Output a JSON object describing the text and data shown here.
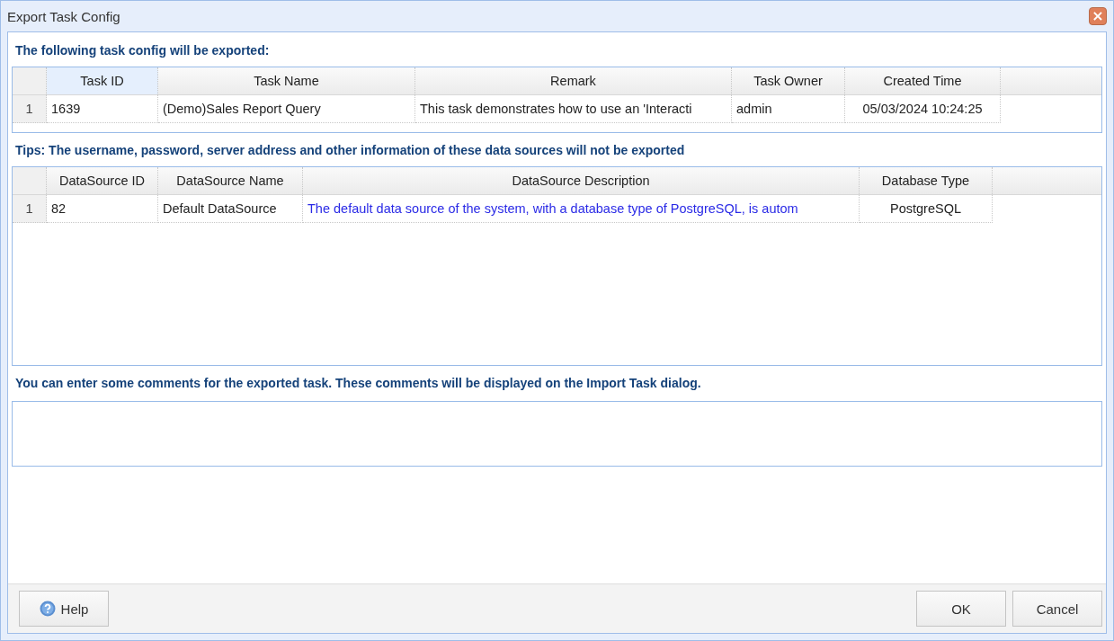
{
  "window": {
    "title": "Export Task Config",
    "close": "×"
  },
  "task_section": {
    "heading": "The following task config will be exported:",
    "columns": [
      {
        "label": "Task ID",
        "selected": true
      },
      {
        "label": "Task Name",
        "selected": false
      },
      {
        "label": "Remark",
        "selected": false
      },
      {
        "label": "Task Owner",
        "selected": false
      },
      {
        "label": "Created Time",
        "selected": false
      }
    ],
    "rows": [
      {
        "row_number": "1",
        "cells": [
          "1639",
          "(Demo)Sales Report Query",
          "This task demonstrates how to use an 'Interacti",
          "admin",
          "05/03/2024 10:24:25"
        ]
      }
    ]
  },
  "datasource_section": {
    "heading": "Tips: The username, password, server address and other information of these data sources will not be exported",
    "columns": [
      {
        "label": "DataSource ID"
      },
      {
        "label": "DataSource Name"
      },
      {
        "label": "DataSource Description"
      },
      {
        "label": "Database Type"
      }
    ],
    "rows": [
      {
        "row_number": "1",
        "cells": [
          "82",
          "Default DataSource",
          "The default data source of the system, with a database type of PostgreSQL, is autom",
          "PostgreSQL"
        ]
      }
    ]
  },
  "comments_section": {
    "heading": "You can enter some comments for the exported task. These comments will be displayed on the Import Task dialog."
  },
  "buttons": {
    "help": "Help",
    "ok": "OK",
    "cancel": "Cancel"
  }
}
